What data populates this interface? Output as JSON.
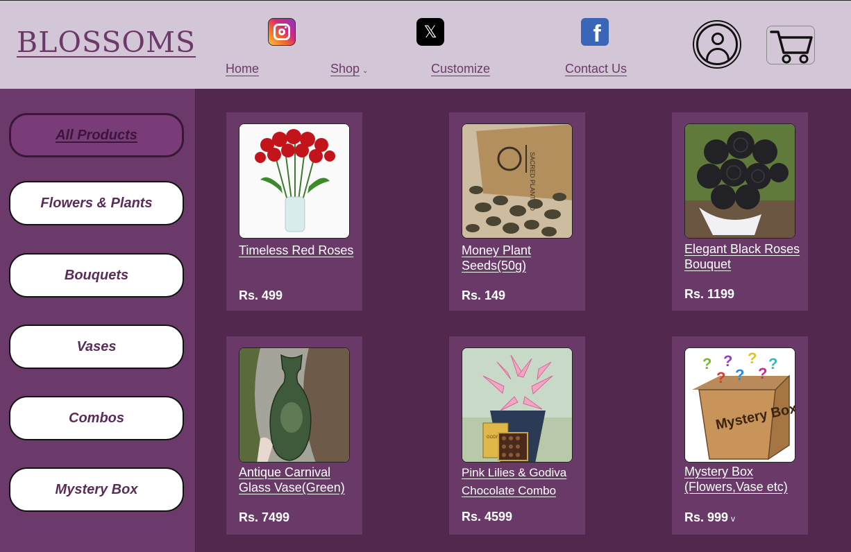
{
  "header": {
    "logo": "BLOSSOMS",
    "nav": [
      {
        "label": "Home"
      },
      {
        "label": "Shop",
        "has_dropdown": true
      },
      {
        "label": "Customize"
      },
      {
        "label": "Contact Us"
      }
    ],
    "social": [
      "instagram-icon",
      "x-icon",
      "facebook-icon"
    ],
    "x_glyph": "𝕏",
    "fb_glyph": "f",
    "nav_chev": "⌄"
  },
  "sidebar": {
    "items": [
      {
        "label": "All Products",
        "active": true
      },
      {
        "label": "Flowers & Plants"
      },
      {
        "label": "Bouquets"
      },
      {
        "label": "Vases"
      },
      {
        "label": "Combos"
      },
      {
        "label": "Mystery Box"
      }
    ]
  },
  "products": [
    {
      "name": "Timeless Red Roses",
      "price": "Rs. 499",
      "image": "red-roses-vase"
    },
    {
      "name": "Money Plant Seeds(50g)",
      "price": "Rs. 149",
      "image": "seeds-pack"
    },
    {
      "name": "Elegant Black Roses Bouquet",
      "price": "Rs. 1199",
      "image": "black-roses-bouquet"
    },
    {
      "name": "Antique Carnival Glass Vase(Green)",
      "price": "Rs. 7499",
      "image": "green-glass-vase"
    },
    {
      "name": "Pink Lilies & Godiva Chocolate Combo",
      "price": "Rs. 4599",
      "image": "lilies-chocolate"
    },
    {
      "name": "Mystery Box (Flowers,Vase etc)",
      "price": "Rs. 999",
      "image": "mystery-box",
      "price_chev": "v"
    }
  ],
  "image_text": {
    "seed_pack": "SACRED PLANT CO",
    "mystery_box": "Mystery Box",
    "chocolate": "GODIVA"
  },
  "colors": {
    "header_bg": "#d3c6d6",
    "page_bg": "#52284f",
    "sidebar_bg": "#6b3a6a",
    "card_bg": "#693a68",
    "accent": "#6b3a6a"
  }
}
